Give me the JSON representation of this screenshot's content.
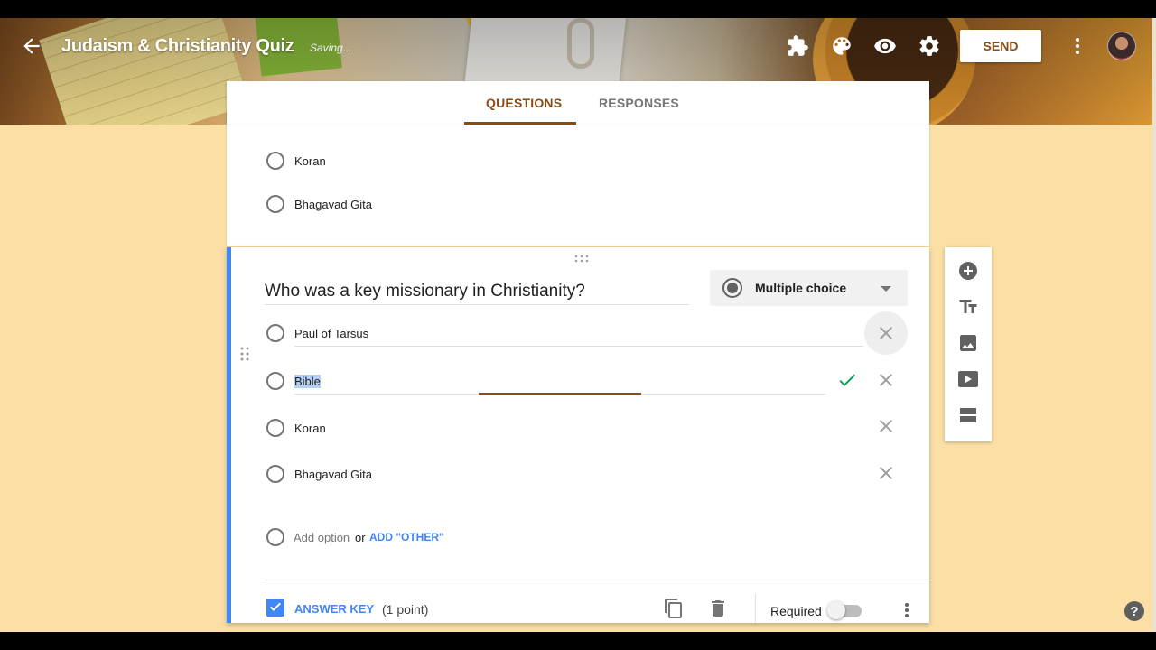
{
  "header": {
    "title": "Judaism & Christianity Quiz",
    "status": "Saving...",
    "send_label": "SEND",
    "icons": [
      "addons-icon",
      "palette-icon",
      "preview-eye-icon",
      "settings-gear-icon",
      "more-vert-icon"
    ]
  },
  "tabs": [
    {
      "label": "QUESTIONS",
      "active": true
    },
    {
      "label": "RESPONSES",
      "active": false
    }
  ],
  "previous_question": {
    "options": [
      "Koran",
      "Bhagavad Gita"
    ]
  },
  "question": {
    "title": "Who was a key missionary in Christianity?",
    "type": "Multiple choice",
    "options": [
      {
        "text": "Paul of Tarsus"
      },
      {
        "text": "Bible",
        "selected_text": true,
        "marked_correct": true
      },
      {
        "text": "Koran"
      },
      {
        "text": "Bhagavad Gita"
      }
    ],
    "add_option": "Add option",
    "or": "or",
    "add_other": "ADD \"OTHER\"",
    "answer_key_label": "ANSWER KEY",
    "points": "(1 point)",
    "required_label": "Required",
    "required": false
  },
  "toolbar": {
    "tools": [
      "add-question-icon",
      "title-text-icon",
      "image-icon",
      "video-icon",
      "section-icon"
    ]
  },
  "help": "?",
  "colors": {
    "accent": "#8a4b14",
    "background": "#fbdfa5",
    "blue": "#4285f4",
    "check_green": "#0f9d58"
  }
}
